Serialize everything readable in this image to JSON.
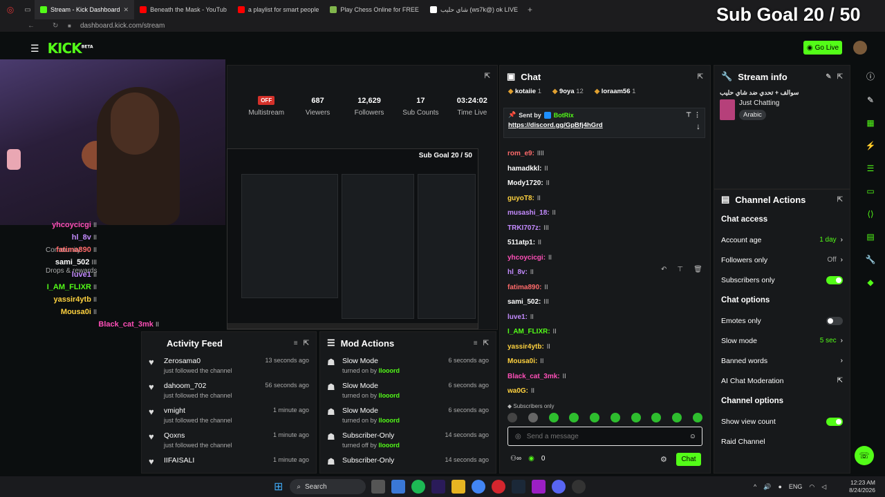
{
  "browser": {
    "tabs": [
      {
        "label": "Stream - Kick Dashboard",
        "color": "#53fc18",
        "active": true
      },
      {
        "label": "Beneath the Mask - YouTub",
        "color": "#ff0000",
        "active": false
      },
      {
        "label": "a playlist for smart people",
        "color": "#ff0000",
        "active": false
      },
      {
        "label": "Play Chess Online for FREE",
        "color": "#81b64c",
        "active": false
      },
      {
        "label": "شاي حليب (ws7k@) ok LIVE",
        "color": "#ffffff",
        "active": false
      }
    ],
    "url": "dashboard.kick.com/stream"
  },
  "overlay": {
    "sub_goal": "Sub Goal 20 / 50",
    "mini_sub_goal": "Sub Goal 20 / 50"
  },
  "topbar": {
    "logo": "KICK",
    "logo_sup": "BETA",
    "go_live": "Go Live"
  },
  "stats": [
    {
      "value": "OFF",
      "label": "Multistream"
    },
    {
      "value": "687",
      "label": "Viewers"
    },
    {
      "value": "12,629",
      "label": "Followers"
    },
    {
      "value": "17",
      "label": "Sub Counts"
    },
    {
      "value": "03:24:02",
      "label": "Time Live"
    }
  ],
  "left_overlay_chat": [
    {
      "name": "yhcoycicgi",
      "text": "اا",
      "color": "#ff4fb8"
    },
    {
      "name": "hl_8v",
      "text": "اا",
      "color": "#c48bff"
    },
    {
      "name": "fatima890",
      "text": "اا",
      "color": "#ff6a6a"
    },
    {
      "name": "sami_502",
      "text": "ااا",
      "color": "#ffffff"
    },
    {
      "name": "luve1",
      "text": "اا",
      "color": "#c48bff"
    },
    {
      "name": "I_AM_FLIXR",
      "text": "اا",
      "color": "#53fc18"
    },
    {
      "name": "yassir4ytb",
      "text": "اا",
      "color": "#ffd23f"
    },
    {
      "name": "Mousa0i",
      "text": "اا",
      "color": "#ffd23f"
    },
    {
      "name": "Black_cat_3mk",
      "text": "اا",
      "color": "#ff4fb8"
    }
  ],
  "left_nav": {
    "community": "Community",
    "drops": "Drops & rewards"
  },
  "activity": {
    "title": "Activity Feed",
    "items": [
      {
        "user": "Zerosama0",
        "text": "just followed the channel",
        "time": "13 seconds ago"
      },
      {
        "user": "dahoom_702",
        "text": "just followed the channel",
        "time": "56 seconds ago"
      },
      {
        "user": "vmight",
        "text": "just followed the channel",
        "time": "1 minute ago"
      },
      {
        "user": "Qoxns",
        "text": "just followed the channel",
        "time": "1 minute ago"
      },
      {
        "user": "IIFAISALI",
        "text": "",
        "time": "1 minute ago"
      }
    ]
  },
  "mod_actions": {
    "title": "Mod Actions",
    "items": [
      {
        "action": "Slow Mode",
        "prefix": "turned on by",
        "by": "llooord",
        "time": "6 seconds ago"
      },
      {
        "action": "Slow Mode",
        "prefix": "turned on by",
        "by": "llooord",
        "time": "6 seconds ago"
      },
      {
        "action": "Slow Mode",
        "prefix": "turned on by",
        "by": "llooord",
        "time": "6 seconds ago"
      },
      {
        "action": "Subscriber-Only",
        "prefix": "turned off by",
        "by": "llooord",
        "time": "14 seconds ago"
      },
      {
        "action": "Subscriber-Only",
        "prefix": "",
        "by": "",
        "time": "14 seconds ago"
      }
    ]
  },
  "chat": {
    "title": "Chat",
    "top_gifters": [
      {
        "name": "kotaiie",
        "count": "1"
      },
      {
        "name": "9oya",
        "count": "12"
      },
      {
        "name": "loraam56",
        "count": "1"
      }
    ],
    "pinned": {
      "sent_by": "Sent by",
      "user": "BotRix",
      "link": "https://discord.gg/GpBfj4hGrd"
    },
    "messages": [
      {
        "name": "rom_e9:",
        "text": "اااا",
        "color": "#ff6a6a"
      },
      {
        "name": "hamadkkl:",
        "text": "اا",
        "color": "#ffffff"
      },
      {
        "name": "Mody1720:",
        "text": "اا",
        "color": "#ffffff"
      },
      {
        "name": "guyoT8:",
        "text": "اا",
        "color": "#ffd23f"
      },
      {
        "name": "musashi_18:",
        "text": "اا",
        "color": "#c48bff"
      },
      {
        "name": "TRKI707z:",
        "text": "ااا",
        "color": "#c48bff"
      },
      {
        "name": "511atp1:",
        "text": "اا",
        "color": "#ffffff"
      },
      {
        "name": "yhcoycicgi:",
        "text": "اا",
        "color": "#ff4fb8"
      },
      {
        "name": "hl_8v:",
        "text": "اا",
        "color": "#c48bff"
      },
      {
        "name": "fatima890:",
        "text": "اا",
        "color": "#ff6a6a"
      },
      {
        "name": "sami_502:",
        "text": "ااا",
        "color": "#ffffff"
      },
      {
        "name": "luve1:",
        "text": "اا",
        "color": "#c48bff"
      },
      {
        "name": "I_AM_FLIXR:",
        "text": "اا",
        "color": "#53fc18"
      },
      {
        "name": "yassir4ytb:",
        "text": "اا",
        "color": "#ffd23f"
      },
      {
        "name": "Mousa0i:",
        "text": "اا",
        "color": "#ffd23f"
      },
      {
        "name": "Black_cat_3mk:",
        "text": "اا",
        "color": "#ff4fb8"
      },
      {
        "name": "wa0G:",
        "text": "اا",
        "color": "#ffd23f"
      }
    ],
    "subscribers_only": "Subscribers only",
    "placeholder": "Send a message",
    "points": "0",
    "send": "Chat"
  },
  "stream_info": {
    "title": "Stream info",
    "stream_title": "سوالف + تحدي ضد شاي حليب",
    "category": "Just Chatting",
    "language": "Arabic"
  },
  "channel_actions": {
    "title": "Channel Actions",
    "chat_access": "Chat access",
    "account_age": {
      "label": "Account age",
      "value": "1 day"
    },
    "followers_only": {
      "label": "Followers only",
      "value": "Off"
    },
    "subscribers_only": {
      "label": "Subscribers only",
      "on": true
    },
    "chat_options": "Chat options",
    "emotes_only": {
      "label": "Emotes only",
      "on": false
    },
    "slow_mode": {
      "label": "Slow mode",
      "value": "5 sec"
    },
    "banned_words": "Banned words",
    "ai_moderation": "AI Chat Moderation",
    "channel_options": "Channel options",
    "show_view_count": {
      "label": "Show view count",
      "on": true
    },
    "raid_channel": "Raid Channel"
  },
  "taskbar": {
    "search": "Search",
    "lang": "ENG",
    "time": "12:23 AM",
    "date": "8/24/2026"
  },
  "colors": {
    "accent": "#53fc18",
    "panel": "#17191b",
    "bg": "#0b0e0f"
  }
}
